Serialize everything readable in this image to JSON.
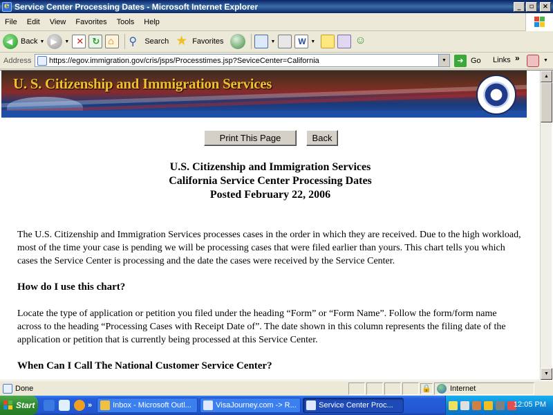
{
  "window": {
    "title": "Service Center Processing Dates - Microsoft Internet Explorer",
    "min": "_",
    "max": "▫",
    "close": "×"
  },
  "menu": [
    "File",
    "Edit",
    "View",
    "Favorites",
    "Tools",
    "Help"
  ],
  "toolbar": {
    "back_label": "Back",
    "search_label": "Search",
    "favorites_label": "Favorites"
  },
  "address": {
    "label": "Address",
    "url": "https://egov.immigration.gov/cris/jsps/Processtimes.jsp?SeviceCenter=California",
    "go_label": "Go",
    "links_label": "Links",
    "links_chevron": "»"
  },
  "banner": {
    "title": "U. S. Citizenship and Immigration Services"
  },
  "page": {
    "print_button": "Print This Page",
    "back_button": "Back",
    "heading_line1": "U.S. Citizenship and Immigration Services",
    "heading_line2": "California Service Center Processing Dates",
    "heading_line3": "Posted February 22, 2006",
    "para1": "The U.S. Citizenship and Immigration Services processes cases in the order in which they are received. Due to the high workload, most of the time your case is pending we will be processing cases that were filed earlier than yours. This chart tells you which cases the Service Center is processing and the date the cases were received by the Service Center.",
    "question1": "How do I use this chart?",
    "para2": "Locate the type of application or petition you filed under the heading “Form” or “Form Name”. Follow the form/form name across to the heading “Processing Cases with Receipt Date of”. The date shown in this column represents the filing date of the application or petition that is currently being processed at this Service Center.",
    "question2": "When Can I Call The National Customer Service Center?"
  },
  "status": {
    "text": "Done",
    "zone": "Internet"
  },
  "taskbar": {
    "start_label": "Start",
    "chevron": "»",
    "tasks": [
      {
        "label": "Inbox - Microsoft Outl...",
        "active": false
      },
      {
        "label": "VisaJourney.com -> R...",
        "active": false
      },
      {
        "label": "Service Center Proc...",
        "active": true
      }
    ],
    "clock": "12:05 PM"
  },
  "colors": {
    "titlebar": "#0a246a",
    "banner_text": "#f0c030",
    "taskbar": "#245edb",
    "start": "#2f8a2f"
  }
}
